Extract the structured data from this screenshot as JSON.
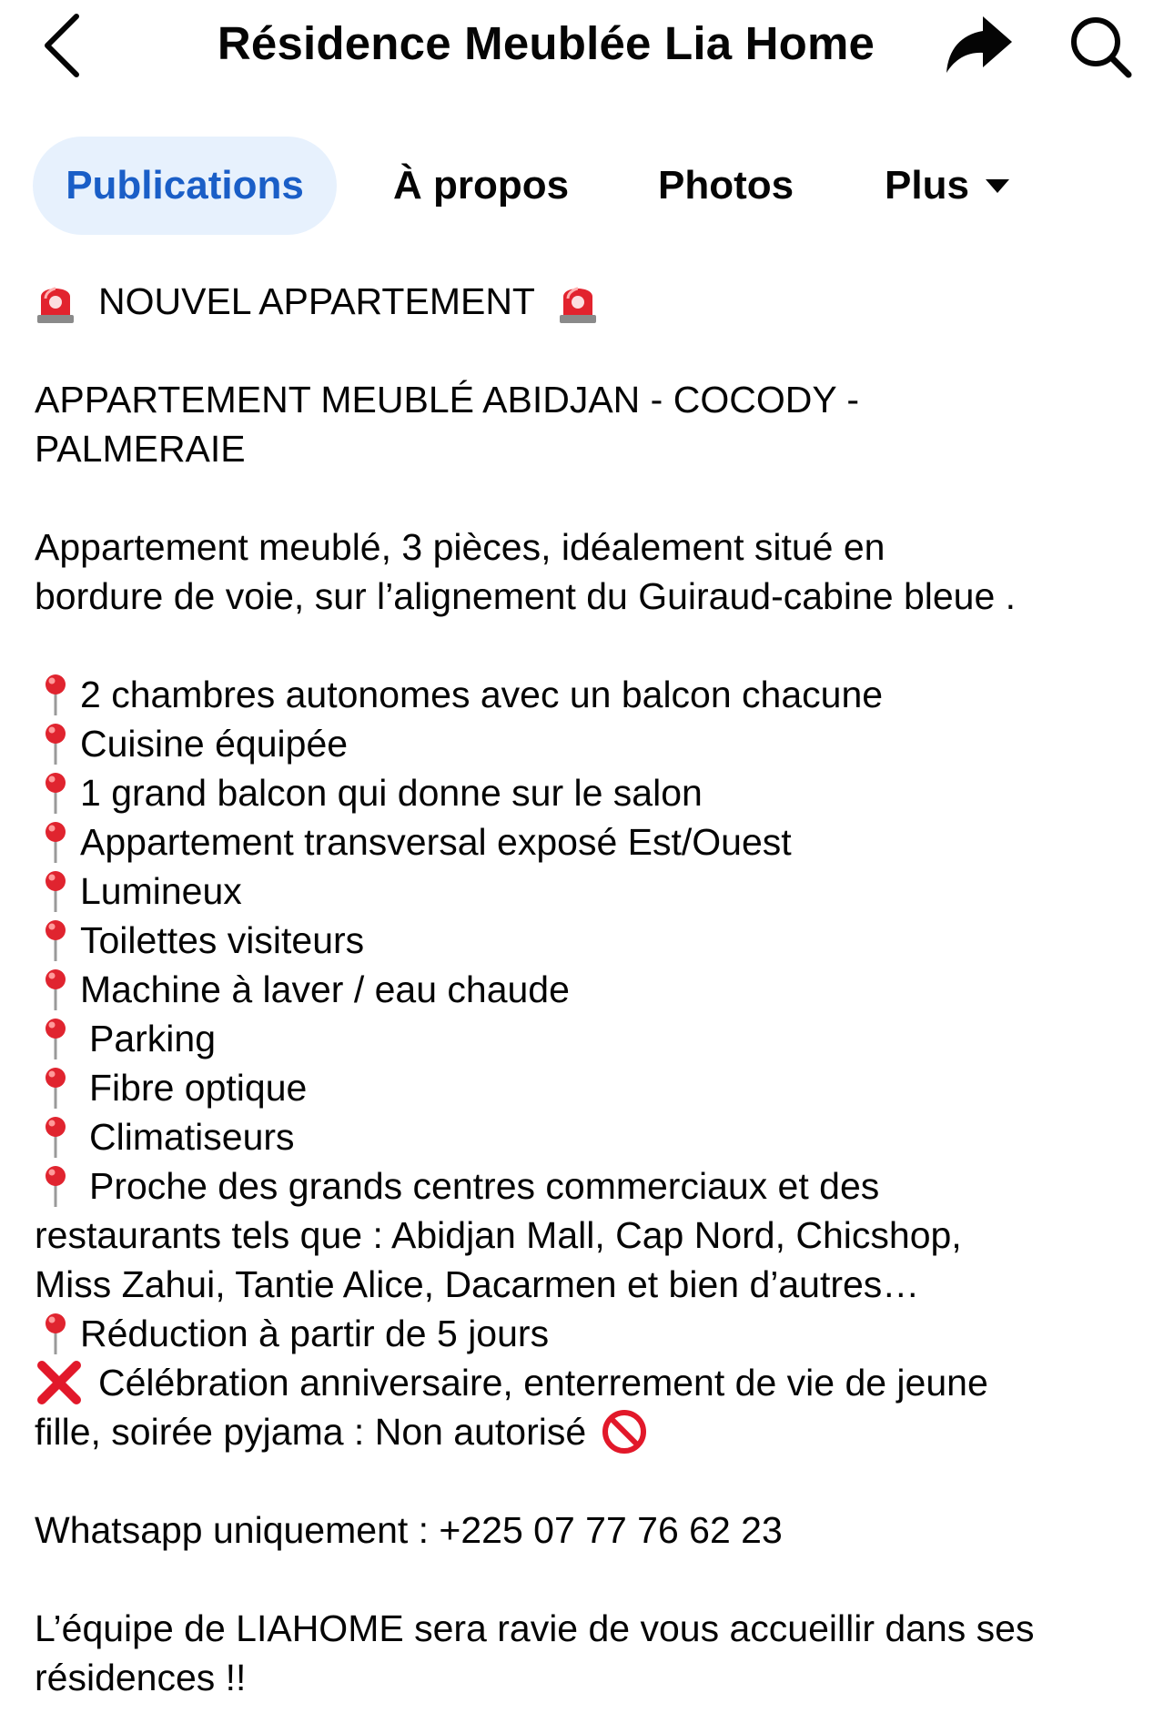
{
  "header": {
    "title": "Résidence Meublée Lia Home",
    "back_icon": "chevron-left-icon",
    "share_icon": "share-arrow-icon",
    "search_icon": "search-icon"
  },
  "tabs": [
    {
      "label": "Publications",
      "active": true
    },
    {
      "label": "À propos",
      "active": false
    },
    {
      "label": "Photos",
      "active": false
    },
    {
      "label": "Plus",
      "active": false,
      "icon": "caret-down-icon"
    }
  ],
  "colors": {
    "accent": "#1a5ec7",
    "active_tab_bg": "#e7f1fd",
    "pin_red": "#e0242f",
    "siren_red": "#e2232e"
  },
  "post": {
    "headline": "NOUVEL APPARTEMENT",
    "subtitle_line1": "APPARTEMENT MEUBLÉ ABIDJAN - COCODY -",
    "subtitle_line2": "PALMERAIE",
    "desc_line1": "Appartement meublé, 3 pièces, idéalement situé en",
    "desc_line2": "bordure de voie, sur l’alignement du Guiraud-cabine bleue .",
    "features": [
      "2 chambres autonomes avec un balcon chacune",
      "Cuisine équipée",
      "1 grand balcon qui donne sur le salon",
      "Appartement transversal exposé Est/Ouest",
      "Lumineux",
      "Toilettes visiteurs",
      "Machine à laver / eau chaude",
      "Parking",
      "Fibre optique",
      "Climatiseurs",
      "Proche des grands centres commerciaux et des"
    ],
    "proche_line2": "restaurants tels que : Abidjan Mall, Cap Nord, Chicshop,",
    "proche_line3": "Miss Zahui, Tantie Alice, Dacarmen et bien d’autres…",
    "reduction": "Réduction à partir de 5 jours",
    "forbidden_line1": "Célébration anniversaire, enterrement de vie de jeune",
    "forbidden_line2": "fille, soirée pyjama : Non autorisé",
    "whatsapp": "Whatsapp uniquement : +225 07 77 76 62 23",
    "closing_line1": "L’équipe de LIAHOME sera ravie de vous accueillir dans ses",
    "closing_line2": "résidences !!"
  }
}
